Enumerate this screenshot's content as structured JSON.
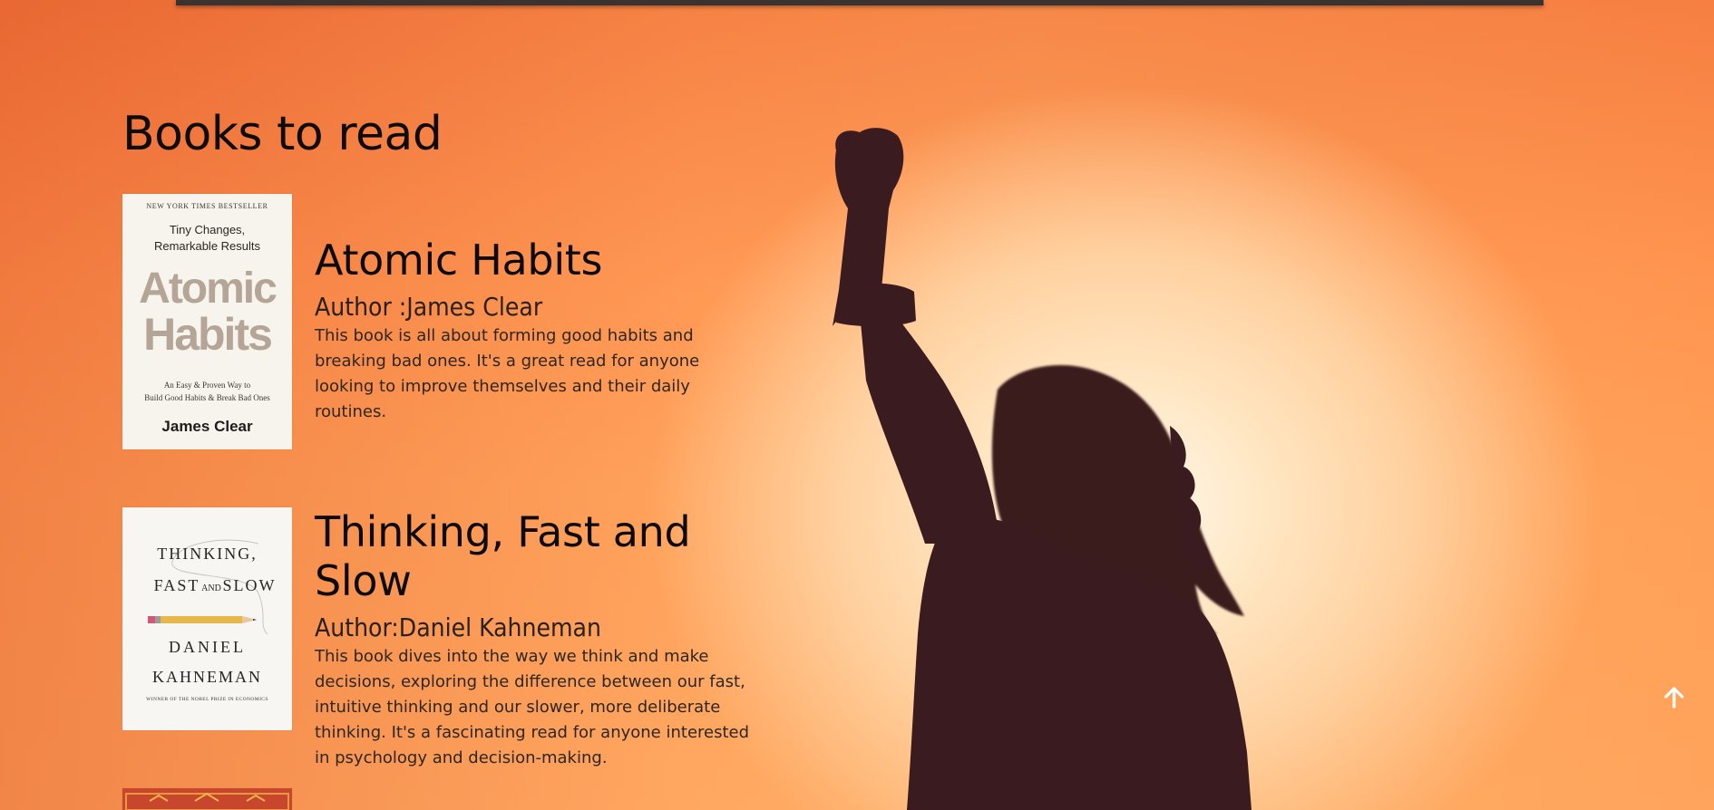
{
  "page": {
    "title": "Books to read"
  },
  "books": [
    {
      "title": "Atomic Habits",
      "author": "Author :James Clear",
      "description": "This book is all about forming good habits and breaking bad ones. It's a great read for anyone looking to improve themselves and their daily routines.",
      "cover": {
        "top_line": "NEW YORK TIMES BESTSELLER",
        "tagline_1": "Tiny Changes,",
        "tagline_2": "Remarkable Results",
        "title_1": "Atomic",
        "title_2": "Habits",
        "subtitle_1": "An Easy & Proven Way to",
        "subtitle_2": "Build Good Habits & Break Bad Ones",
        "author": "James Clear"
      }
    },
    {
      "title": "Thinking, Fast and Slow",
      "author": "Author:Daniel Kahneman",
      "description": "This book dives into the way we think and make decisions, exploring the difference between our fast, intuitive thinking and our slower, more deliberate thinking. It's a fascinating read for anyone interested in psychology and decision-making.",
      "cover": {
        "title_1": "THINKING,",
        "title_2a": "FAST",
        "title_2b": "AND",
        "title_2c": "SLOW",
        "author_1": "DANIEL",
        "author_2": "KAHNEMAN",
        "footer": "WINNER OF THE NOBEL PRIZE IN ECONOMICS"
      }
    }
  ],
  "scroll_top": {
    "icon": "arrow-up-icon"
  },
  "colors": {
    "silhouette": "#3a1b1f",
    "heading": "#0c0a0a",
    "body_text": "#2e2622"
  }
}
